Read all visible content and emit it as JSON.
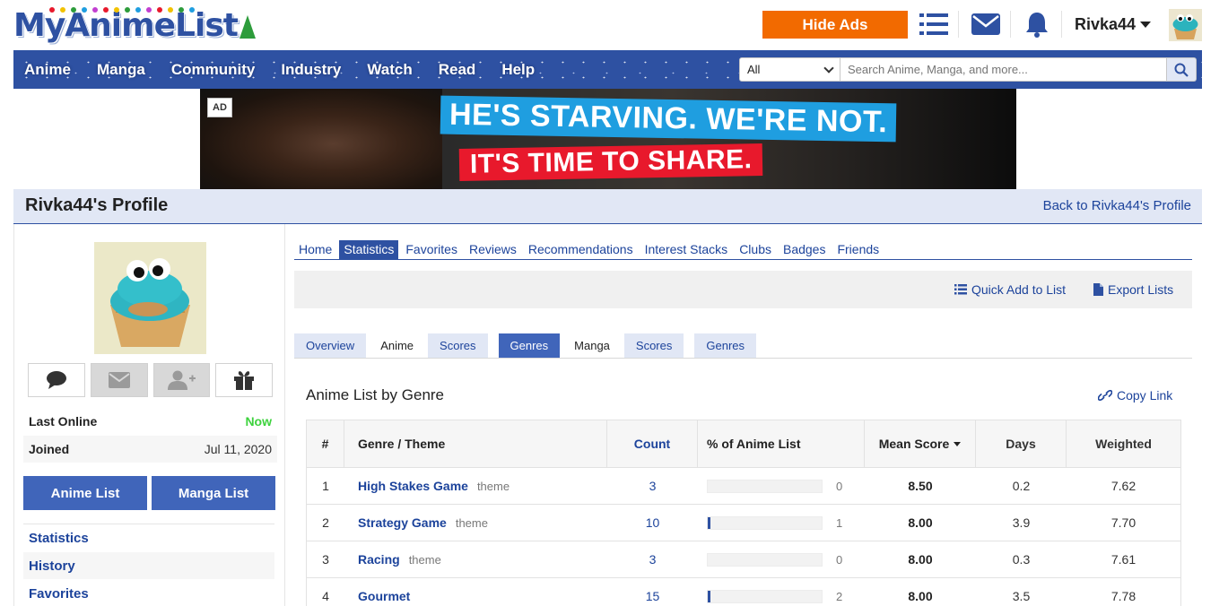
{
  "header": {
    "logo_text": "MyAnimeList",
    "hide_ads_label": "Hide Ads",
    "username": "Rivka44"
  },
  "nav": {
    "items": [
      "Anime",
      "Manga",
      "Community",
      "Industry",
      "Watch",
      "Read",
      "Help"
    ],
    "search_scope": "All",
    "search_placeholder": "Search Anime, Manga, and more..."
  },
  "ad": {
    "badge": "AD",
    "line_1": "HE'S STARVING. WE'RE NOT.",
    "line_2": "IT'S TIME TO SHARE."
  },
  "profile": {
    "title": "Rivka44's Profile",
    "back_link": "Back to Rivka44's Profile"
  },
  "sidebar": {
    "last_online_label": "Last Online",
    "last_online_value": "Now",
    "joined_label": "Joined",
    "joined_value": "Jul 11, 2020",
    "anime_list_label": "Anime List",
    "manga_list_label": "Manga List",
    "links": [
      "Statistics",
      "History",
      "Favorites"
    ]
  },
  "profile_tabs": {
    "items": [
      "Home",
      "Statistics",
      "Favorites",
      "Reviews",
      "Recommendations",
      "Interest Stacks",
      "Clubs",
      "Badges",
      "Friends"
    ],
    "active": "Statistics"
  },
  "toolbar": {
    "quick_add": "Quick Add to List",
    "export_lists": "Export Lists"
  },
  "stat_tabs": {
    "overview": "Overview",
    "anime_label": "Anime",
    "anime_scores": "Scores",
    "anime_genres": "Genres",
    "manga_label": "Manga",
    "manga_scores": "Scores",
    "manga_genres": "Genres"
  },
  "section": {
    "title": "Anime List by Genre",
    "copy_link": "Copy Link"
  },
  "table": {
    "headers": {
      "num": "#",
      "genre": "Genre / Theme",
      "count": "Count",
      "pct": "% of Anime List",
      "mean": "Mean Score",
      "days": "Days",
      "weighted": "Weighted"
    },
    "rows": [
      {
        "num": "1",
        "name": "High Stakes Game",
        "tag": "theme",
        "count": "3",
        "pct": "0",
        "pct_fill": 0,
        "mean": "8.50",
        "days": "0.2",
        "weighted": "7.62"
      },
      {
        "num": "2",
        "name": "Strategy Game",
        "tag": "theme",
        "count": "10",
        "pct": "1",
        "pct_fill": 1,
        "mean": "8.00",
        "days": "3.9",
        "weighted": "7.70"
      },
      {
        "num": "3",
        "name": "Racing",
        "tag": "theme",
        "count": "3",
        "pct": "0",
        "pct_fill": 0,
        "mean": "8.00",
        "days": "0.3",
        "weighted": "7.61"
      },
      {
        "num": "4",
        "name": "Gourmet",
        "tag": "",
        "count": "15",
        "pct": "2",
        "pct_fill": 2,
        "mean": "8.00",
        "days": "3.5",
        "weighted": "7.78"
      }
    ]
  }
}
